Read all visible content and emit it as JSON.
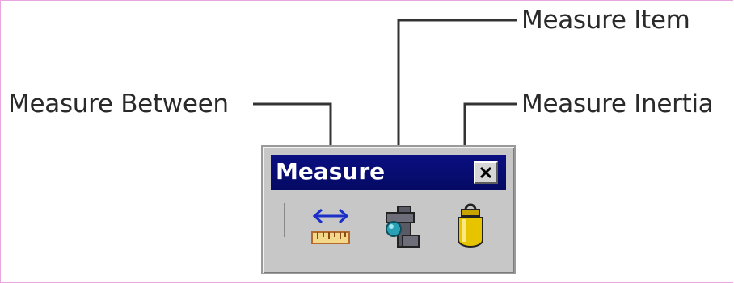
{
  "callouts": {
    "measure_between": "Measure Between",
    "measure_item": "Measure Item",
    "measure_inertia": "Measure Inertia"
  },
  "toolbar": {
    "title": "Measure",
    "buttons": [
      {
        "name": "measure-between",
        "icon": "ruler-arrow-icon"
      },
      {
        "name": "measure-item",
        "icon": "caliper-icon"
      },
      {
        "name": "measure-inertia",
        "icon": "weight-icon"
      }
    ],
    "close_icon": "close-icon"
  },
  "colors": {
    "title_bar": "#0a0f82",
    "toolbar_bg": "#c7c7c7",
    "page_border": "#e7a6df"
  }
}
